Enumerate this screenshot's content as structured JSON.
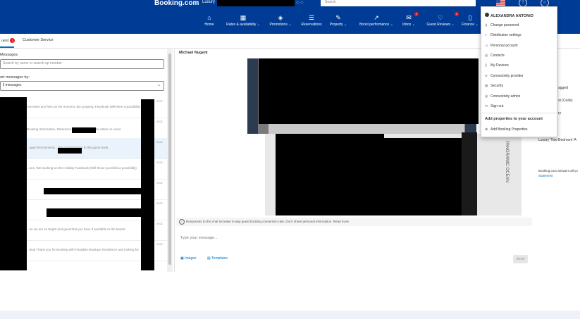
{
  "header": {
    "brand": "Booking.com",
    "property_prefix": "Luxury",
    "search_placeholder": "Search",
    "icons": [
      "flag-us-icon",
      "help-icon",
      "account-icon"
    ]
  },
  "nav": [
    {
      "label": "Home",
      "icon": "home-icon"
    },
    {
      "label": "Rates & availability",
      "icon": "calendar-icon",
      "chevron": true
    },
    {
      "label": "Promotions",
      "icon": "tag-icon",
      "chevron": true
    },
    {
      "label": "Reservations",
      "icon": "list-icon"
    },
    {
      "label": "Property",
      "icon": "pencil-icon",
      "chevron": true
    },
    {
      "label": "Boost performance",
      "icon": "trend-icon",
      "chevron": true
    },
    {
      "label": "Inbox",
      "icon": "mail-icon",
      "badge": "1",
      "chevron": true
    },
    {
      "label": "Guest Reviews",
      "icon": "heart-icon",
      "badge": "1",
      "chevron": true
    },
    {
      "label": "Finance",
      "icon": "doc-icon",
      "chevron": true
    }
  ],
  "subtabs": {
    "active_label": "uest",
    "active_badge": "1",
    "other": "Customer Service"
  },
  "inbox": {
    "heading": "Messages",
    "search_placeholder": "Search by name or search up number",
    "sort_label": "ort messages by:",
    "sort_value": "ll messages",
    "rows": [
      {
        "text": "Are there any fees on the moment, the property, Facebook Will there a possibility"
      },
      {
        "text": "...bles",
        "is_heading": true
      },
      {
        "text": "Booking Information, Reference for... Regarding the dates on some"
      },
      {
        "text": "...age) Recommend... Recommendation in the guest book"
      },
      {
        "text": "...ace, We booking on the Holiday Facebook (Will those you think a possibility)"
      },
      {
        "text": ""
      },
      {
        "text": ""
      },
      {
        "text": "...se we are so Bright and good that you have it available to the tenant"
      },
      {
        "text": "...lead Thank you for Booking with Paradise Boutique Residence and looking for"
      }
    ],
    "dates": [
      "2022",
      "2022",
      "2022",
      "2022",
      "2022",
      "2022",
      "2022",
      "2022",
      "2022",
      "2022",
      "2022"
    ]
  },
  "chat": {
    "contact_name": "Michael Nugent",
    "notice": "Responses to this chat increase in-app guest booking conversion rate, Don't share personal information. Read more",
    "composer_placeholder": "Type your message...",
    "images_label": "Images",
    "templates_label": "Templates",
    "send_label": "Send",
    "photo_text": "PANORAMIC OCEAN"
  },
  "right_pane": [
    "agged",
    "st (Code)",
    "ry",
    "Luxury 'Two-Bedroom' A",
    "Booking.com answers all yo",
    "Statement"
  ],
  "dropdown": {
    "user_name": "ALEXANDRA ANTONIO",
    "items": [
      {
        "label": "Change password",
        "icon": "key-icon"
      },
      {
        "label": "Distribution settings",
        "icon": "globe-icon"
      },
      {
        "label": "Personal account",
        "icon": "user-icon"
      },
      {
        "label": "Contacts",
        "icon": "contacts-icon"
      },
      {
        "label": "My Devices",
        "icon": "device-icon"
      },
      {
        "label": "Connectivity provider",
        "icon": "link-icon"
      },
      {
        "label": "Security",
        "icon": "shield-icon"
      },
      {
        "label": "Connectivity admin",
        "icon": "admin-icon"
      },
      {
        "label": "Sign out",
        "icon": "signout-icon"
      }
    ],
    "section_title": "Add properties to your account",
    "add_item": {
      "label": "Add Booking Properties",
      "icon": "plus-icon"
    }
  }
}
